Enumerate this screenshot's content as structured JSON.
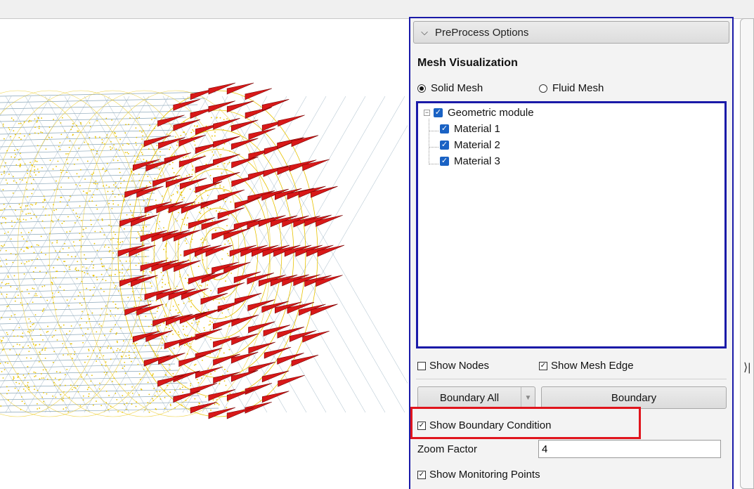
{
  "panel": {
    "header_label": "PreProcess Options",
    "mesh_title": "Mesh Visualization",
    "radios": {
      "solid_label": "Solid Mesh",
      "fluid_label": "Fluid Mesh",
      "selected": "Solid Mesh"
    },
    "tree": {
      "root": "Geometric module",
      "children": [
        "Material 1",
        "Material 2",
        "Material 3"
      ]
    },
    "show_nodes_label": "Show Nodes",
    "show_mesh_edge_label": "Show Mesh Edge",
    "boundary_all_label": "Boundary All",
    "boundary_label": "Boundary",
    "show_boundary_condition_label": "Show Boundary Condition",
    "zoom_factor_label": "Zoom Factor",
    "zoom_factor_value": "4",
    "show_monitoring_points_label": "Show Monitoring Points"
  },
  "checks": {
    "show_nodes": false,
    "show_mesh_edge": true,
    "show_boundary_condition": true,
    "show_monitoring_points": true
  },
  "colors": {
    "panel_border": "#1a1aa8",
    "highlight": "#e0141c",
    "arrow": "#d81818",
    "mesh_yellow": "#e8c200",
    "mesh_wire": "#8aa6b8",
    "checkbox_blue": "#1a62c4"
  },
  "icons": {
    "collapse": "chevron-down-icon",
    "dropdown": "triangle-down-icon",
    "side_toggle": "collapse-right-icon"
  }
}
